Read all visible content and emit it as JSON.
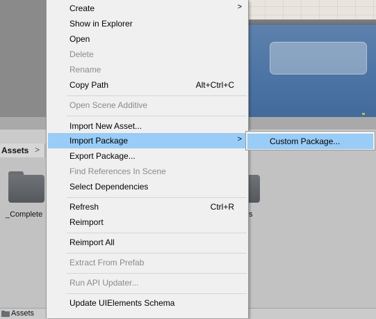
{
  "colors": {
    "menu_background": "#f0f0f0",
    "highlight": "#99ccf6",
    "disabled_text": "#8a8a8a",
    "panel_background": "#c2c2c2"
  },
  "project": {
    "breadcrumb_label": "Assets",
    "breadcrumb_arrow": ">",
    "folder_icon": "folder-icon",
    "folders": [
      {
        "label": "_Complete"
      },
      {
        "label": "s"
      }
    ],
    "status_path": "Assets"
  },
  "context_menu": {
    "submenu_arrow": ">",
    "items": [
      {
        "label": "Create",
        "has_submenu": true,
        "disabled": false
      },
      {
        "label": "Show in Explorer",
        "disabled": false
      },
      {
        "label": "Open",
        "disabled": false
      },
      {
        "label": "Delete",
        "disabled": true
      },
      {
        "label": "Rename",
        "disabled": true
      },
      {
        "label": "Copy Path",
        "shortcut": "Alt+Ctrl+C",
        "disabled": false
      },
      {
        "label": "Open Scene Additive",
        "disabled": true
      },
      {
        "label": "Import New Asset...",
        "disabled": false
      },
      {
        "label": "Import Package",
        "has_submenu": true,
        "highlighted": true,
        "disabled": false
      },
      {
        "label": "Export Package...",
        "disabled": false
      },
      {
        "label": "Find References In Scene",
        "disabled": true
      },
      {
        "label": "Select Dependencies",
        "disabled": false
      },
      {
        "label": "Refresh",
        "shortcut": "Ctrl+R",
        "disabled": false
      },
      {
        "label": "Reimport",
        "disabled": false
      },
      {
        "label": "Reimport All",
        "disabled": false
      },
      {
        "label": "Extract From Prefab",
        "disabled": true
      },
      {
        "label": "Run API Updater...",
        "disabled": true
      },
      {
        "label": "Update UIElements Schema",
        "disabled": false
      }
    ]
  },
  "submenu": {
    "items": [
      {
        "label": "Custom Package...",
        "highlighted": true
      }
    ]
  }
}
